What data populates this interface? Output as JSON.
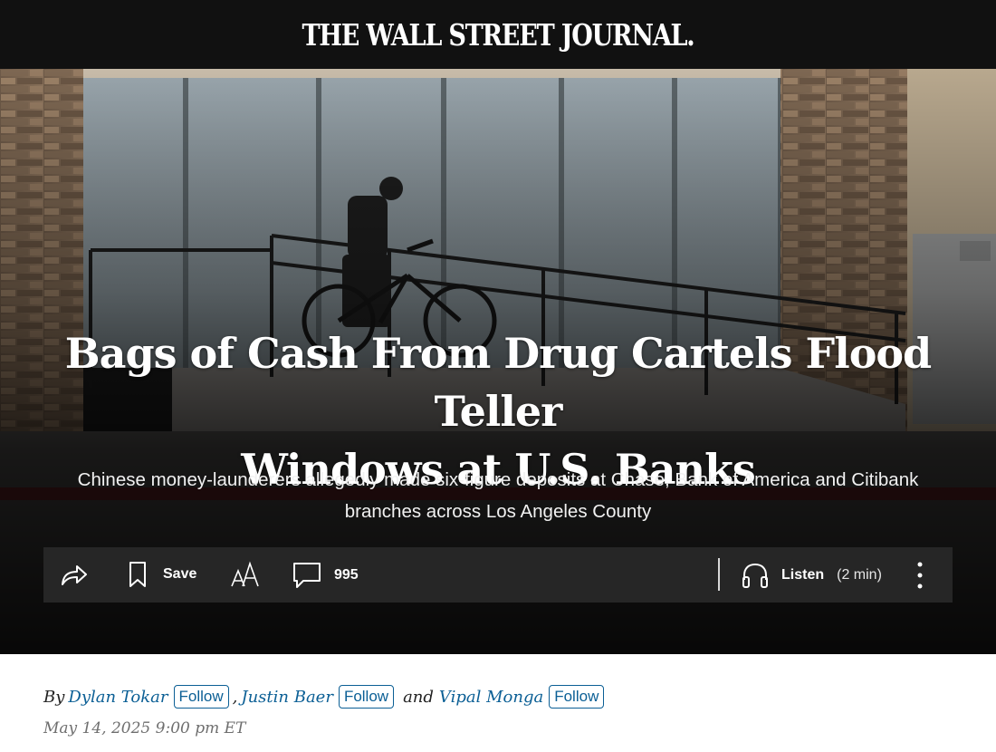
{
  "masthead": {
    "title": "THE WALL STREET JOURNAL."
  },
  "article": {
    "headline_line1": "Bags of Cash From Drug Cartels Flood Teller",
    "headline_line2": "Windows at U.S. Banks",
    "dek_line1": "Chinese money-launderers allegedly made six-figure deposits at Chase, Bank of America and Citibank",
    "dek_line2": "branches across Los Angeles County"
  },
  "toolbar": {
    "share_icon": "share-icon",
    "save_label": "Save",
    "text_size_icon": "text-size-icon",
    "comments_count": "995",
    "listen_label": "Listen",
    "listen_duration": "(2 min)",
    "more_icon": "more-vertical-icon"
  },
  "byline": {
    "by": "By",
    "authors": [
      {
        "name": "Dylan Tokar",
        "follow": "Follow"
      },
      {
        "name": "Justin Baer",
        "follow": "Follow"
      },
      {
        "name": "Vipal Monga",
        "follow": "Follow"
      }
    ],
    "separator": ",",
    "and": "and",
    "date": "May 14, 2025 9:00 pm ET"
  },
  "colors": {
    "topbar": "#111111",
    "toolbar": "#262626",
    "link": "#0b5f95",
    "date": "#6f6f6f"
  }
}
